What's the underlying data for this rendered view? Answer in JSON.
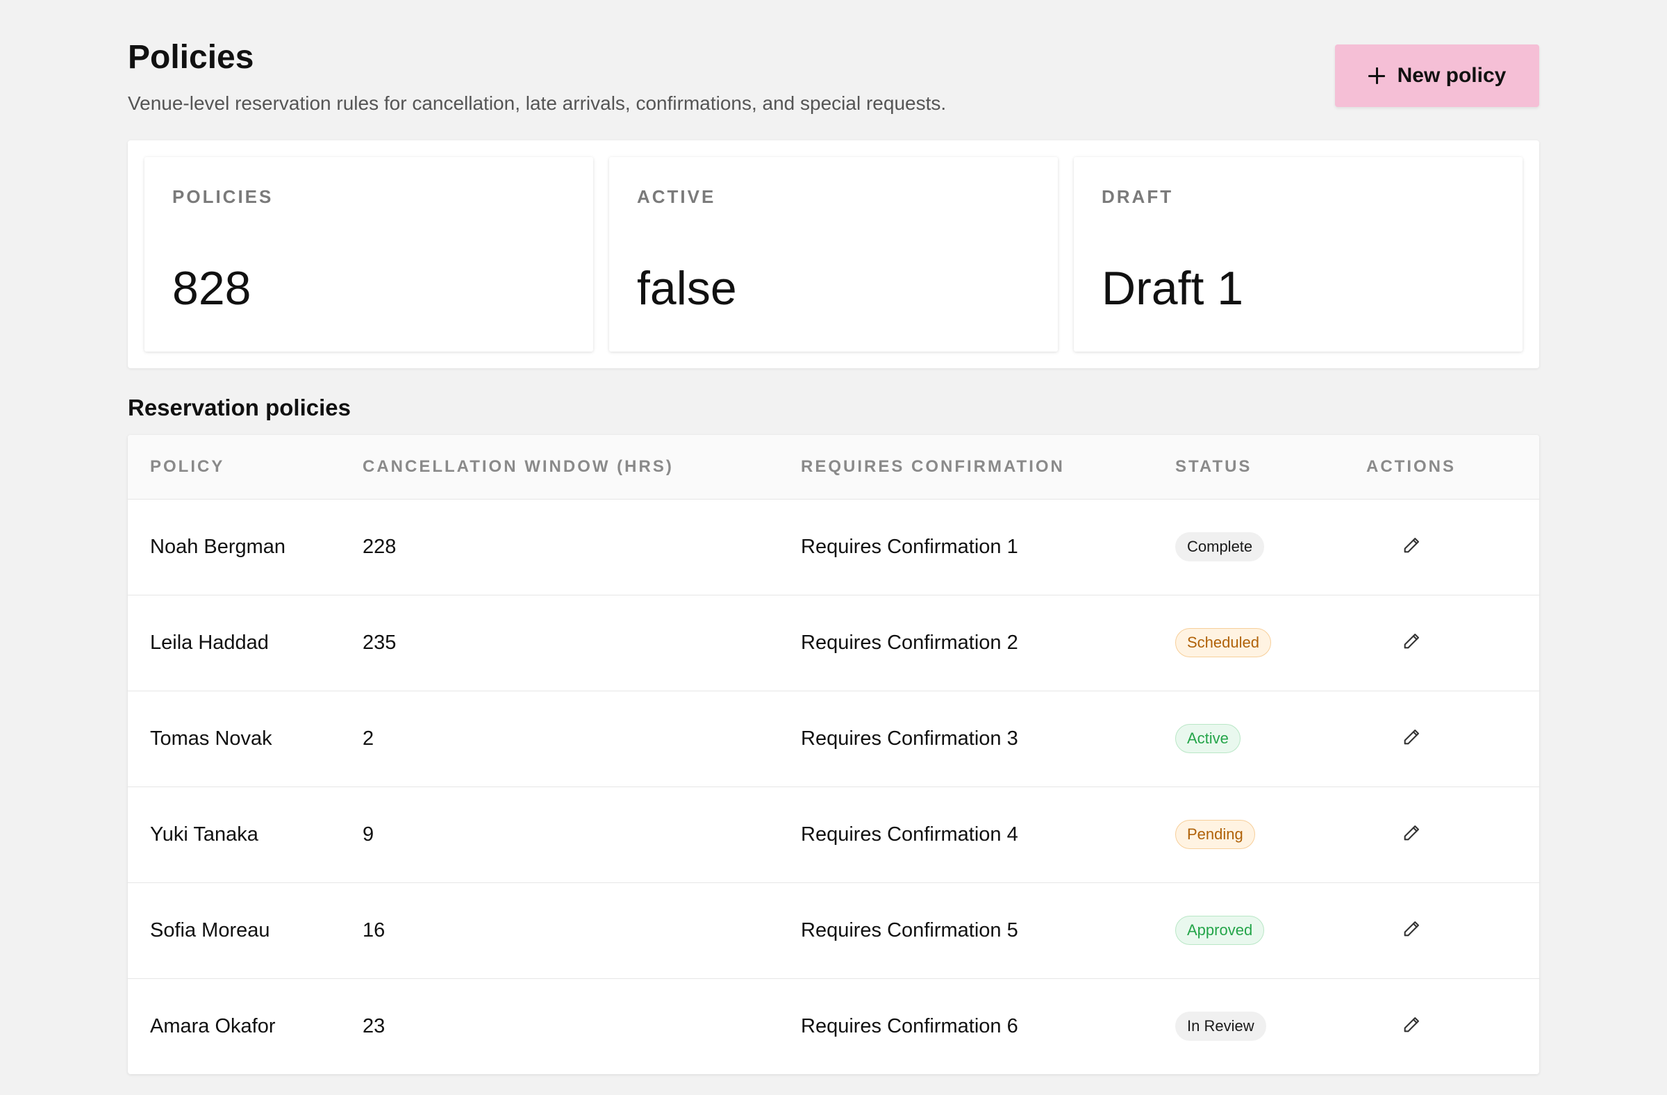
{
  "header": {
    "title": "Policies",
    "subtitle": "Venue-level reservation rules for cancellation, late arrivals, confirmations, and special requests.",
    "new_policy_label": "New policy"
  },
  "stats": [
    {
      "label": "POLICIES",
      "value": "828"
    },
    {
      "label": "ACTIVE",
      "value": "false"
    },
    {
      "label": "DRAFT",
      "value": "Draft 1"
    }
  ],
  "section": {
    "title": "Reservation policies"
  },
  "table": {
    "columns": [
      "POLICY",
      "CANCELLATION WINDOW (HRS)",
      "REQUIRES CONFIRMATION",
      "STATUS",
      "ACTIONS"
    ],
    "rows": [
      {
        "policy": "Noah Bergman",
        "window": "228",
        "confirmation": "Requires Confirmation 1",
        "status": "Complete"
      },
      {
        "policy": "Leila Haddad",
        "window": "235",
        "confirmation": "Requires Confirmation 2",
        "status": "Scheduled"
      },
      {
        "policy": "Tomas Novak",
        "window": "2",
        "confirmation": "Requires Confirmation 3",
        "status": "Active"
      },
      {
        "policy": "Yuki Tanaka",
        "window": "9",
        "confirmation": "Requires Confirmation 4",
        "status": "Pending"
      },
      {
        "policy": "Sofia Moreau",
        "window": "16",
        "confirmation": "Requires Confirmation 5",
        "status": "Approved"
      },
      {
        "policy": "Amara Okafor",
        "window": "23",
        "confirmation": "Requires Confirmation 6",
        "status": "In Review"
      }
    ],
    "action_icon": "pencil-icon"
  },
  "colors": {
    "background": "#f2f2f2",
    "primary_button": "#f5bfd6",
    "text": "#111111",
    "muted": "#7a7a7a"
  }
}
